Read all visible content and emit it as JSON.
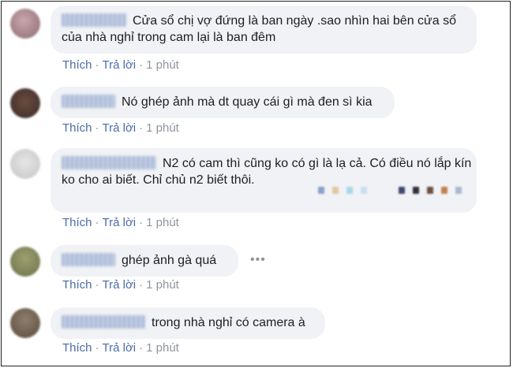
{
  "comments": [
    {
      "text": "Cửa sổ chị vợ đứng là ban ngày .sao nhìn hai bên cửa sổ của nhà nghỉ trong cam lại là ban đêm",
      "like": "Thích",
      "reply": "Trả lời",
      "time": "1 phút",
      "avatar_color": "#b8a0a4"
    },
    {
      "text": "Nó ghép ảnh mà dt quay cái gì mà đen sì kia",
      "like": "Thích",
      "reply": "Trả lời",
      "time": "1 phút",
      "avatar_color": "#5a4038"
    },
    {
      "text": "N2 có cam thì cũng ko có gì là lạ cả. Có điều nó lắp kín ko cho ai biết. Chỉ chủ n2 biết thôi.",
      "like": "Thích",
      "reply": "Trả lời",
      "time": "1 phút",
      "avatar_color": "#d8d8d8"
    },
    {
      "text": "ghép ảnh gà quá",
      "like": "Thích",
      "reply": "Trả lời",
      "time": "1 phút",
      "avatar_color": "#8a9060",
      "more": "•••"
    },
    {
      "text": "trong nhà nghỉ có camera à",
      "like": "Thích",
      "reply": "Trả lời",
      "time": "1 phút",
      "avatar_color": "#807060"
    }
  ],
  "separator": "·"
}
